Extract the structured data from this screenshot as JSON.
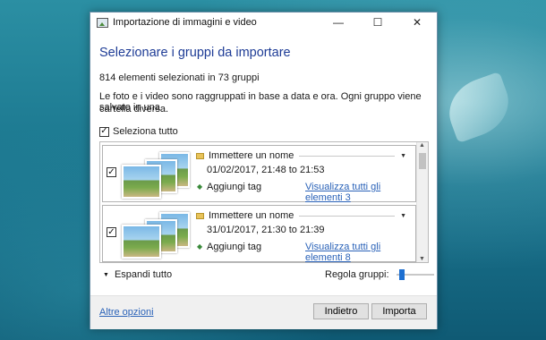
{
  "window": {
    "title": "Importazione di immagini e video",
    "controls": {
      "minimize": "—",
      "maximize": "☐",
      "close": "✕"
    }
  },
  "heading": "Selezionare i gruppi da importare",
  "summary": "814 elementi selezionati in 73 gruppi",
  "description_line1": "Le foto e i video sono raggruppati in base a data e ora. Ogni gruppo viene salvato in una",
  "description_line2": "cartella diversa.",
  "select_all": {
    "label": "Seleziona tutto",
    "checked": true
  },
  "groups": [
    {
      "name": "Immettere un nome",
      "date": "01/02/2017, 21:48 to 21:53",
      "tag": "Aggiungi tag",
      "link": "Visualizza tutti gli elementi 3",
      "checked": true
    },
    {
      "name": "Immettere un nome",
      "date": "31/01/2017, 21:30 to 21:39",
      "tag": "Aggiungi tag",
      "link": "Visualizza tutti gli elementi 8",
      "checked": true
    }
  ],
  "expand_all": "Espandi tutto",
  "group_adjust": {
    "label": "Regola gruppi:",
    "level": 0.1
  },
  "footer": {
    "more_options": "Altre opzioni",
    "back": "Indietro",
    "import": "Importa"
  },
  "colors": {
    "heading": "#1e3c96",
    "link": "#2a62b8",
    "slider": "#1d6fd1"
  }
}
